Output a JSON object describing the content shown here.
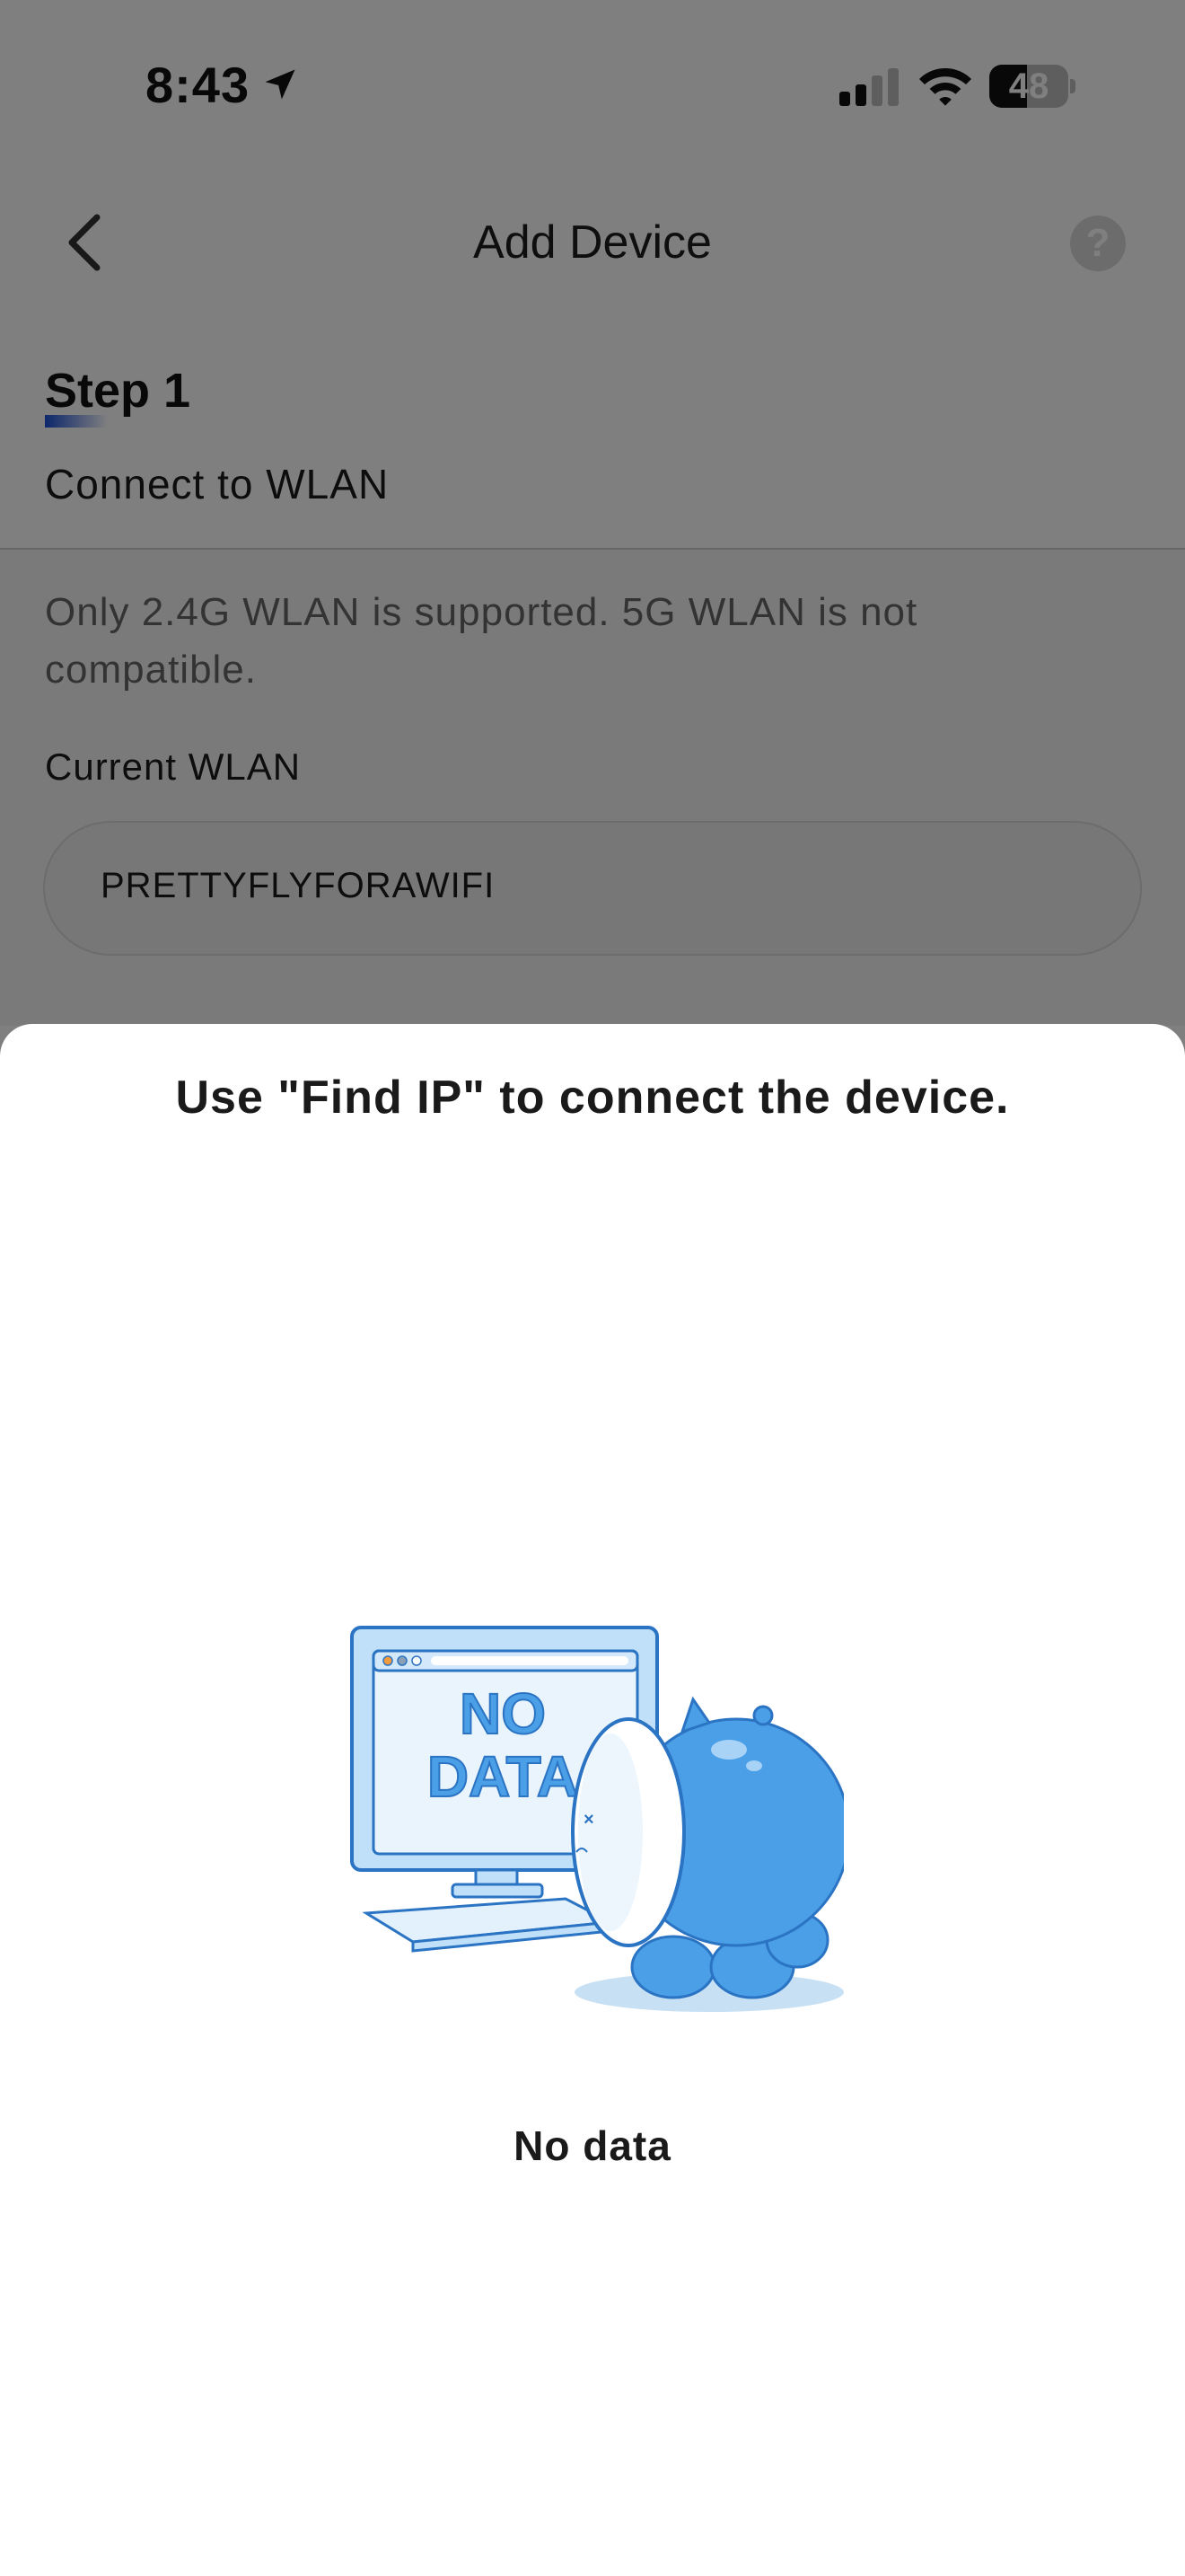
{
  "status_bar": {
    "time": "8:43",
    "battery_level": "48",
    "icons": [
      "location-arrow-icon",
      "cellular-signal-icon",
      "wifi-icon",
      "battery-icon"
    ]
  },
  "nav": {
    "title": "Add Device",
    "back_icon": "chevron-left-icon",
    "help_label": "?"
  },
  "step": {
    "title": "Step 1",
    "subtitle": "Connect to WLAN"
  },
  "notice": "Only 2.4G WLAN is supported. 5G WLAN is not compatible.",
  "wlan": {
    "label": "Current WLAN",
    "value": "PRETTYFLYFORAWIFI"
  },
  "sheet": {
    "title": "Use \"Find IP\" to connect the device.",
    "illustration_text_line1": "NO",
    "illustration_text_line2": "DATA",
    "empty_text": "No data"
  },
  "colors": {
    "accent": "#1a4fd8",
    "illustration_blue": "#4a9fe6",
    "overlay": "rgba(0,0,0,0.5)"
  }
}
